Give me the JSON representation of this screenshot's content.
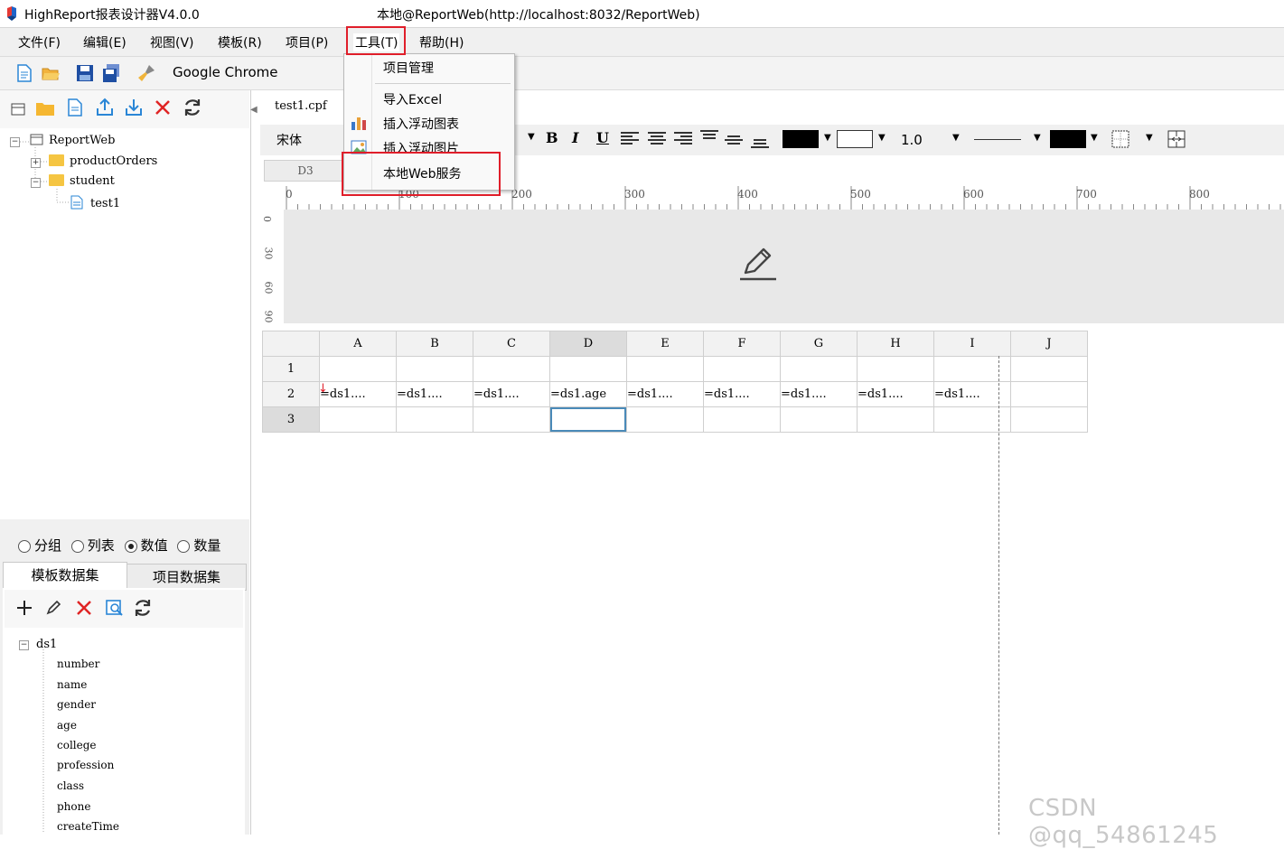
{
  "window": {
    "app_title": "HighReport报表设计器V4.0.0",
    "connection": "本地@ReportWeb(http://localhost:8032/ReportWeb)"
  },
  "menu": [
    "文件(F)",
    "编辑(E)",
    "视图(V)",
    "模板(R)",
    "项目(P)",
    "工具(T)",
    "帮助(H)"
  ],
  "toolbar": {
    "browser": "Google Chrome"
  },
  "tools_menu": {
    "items": [
      "项目管理",
      "导入Excel",
      "插入浮动图表",
      "插入浮动图片",
      "本地Web服务"
    ]
  },
  "project_tree": {
    "root": "ReportWeb",
    "folders": [
      "productOrders",
      "student"
    ],
    "file": "test1"
  },
  "data_mode": {
    "options": [
      "分组",
      "列表",
      "数值",
      "数量"
    ],
    "selected": "数值"
  },
  "dataset_tabs": [
    "模板数据集",
    "项目数据集"
  ],
  "dataset": {
    "name": "ds1",
    "fields": [
      "number",
      "name",
      "gender",
      "age",
      "college",
      "profession",
      "class",
      "phone",
      "createTime"
    ]
  },
  "editor": {
    "doc_tab": "test1.cpf",
    "font": "宋体",
    "cell_ref": "D3",
    "line_width": "1.0",
    "ruler_ticks": [
      "0",
      "100",
      "200",
      "300",
      "400",
      "500",
      "600",
      "700",
      "800"
    ],
    "vruler_ticks": [
      "0",
      "30",
      "60",
      "90"
    ]
  },
  "sheet": {
    "columns": [
      "A",
      "B",
      "C",
      "D",
      "E",
      "F",
      "G",
      "H",
      "I",
      "J"
    ],
    "rows": [
      "1",
      "2",
      "3"
    ],
    "row2": [
      "=ds1....",
      "=ds1....",
      "=ds1....",
      "=ds1.age",
      "=ds1....",
      "=ds1....",
      "=ds1....",
      "=ds1....",
      "=ds1....",
      ""
    ]
  },
  "watermark": "CSDN @qq_54861245",
  "colors": {
    "highlight": "#e01e2a",
    "folder": "#f5c542",
    "selected_cell": "#4a8ab8"
  }
}
